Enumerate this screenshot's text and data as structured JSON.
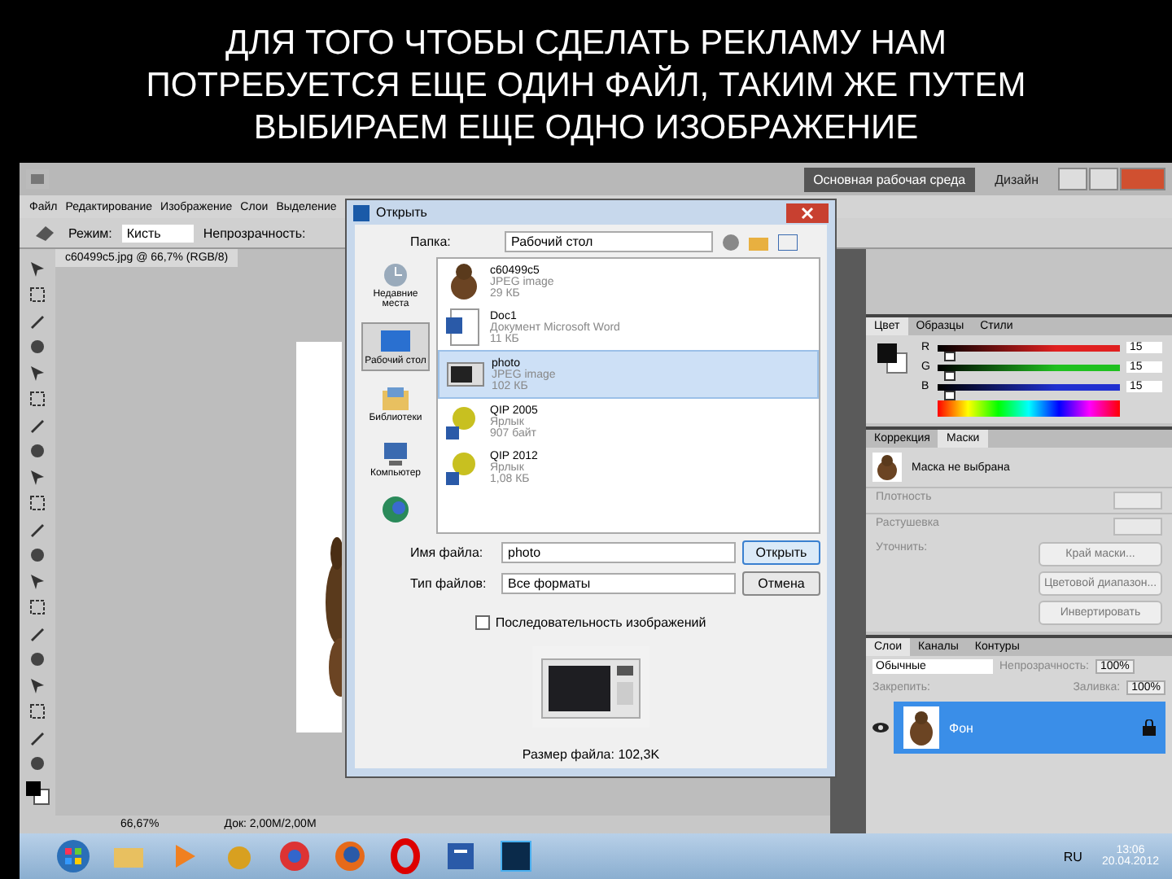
{
  "slide_title": "ДЛЯ ТОГО ЧТОБЫ СДЕЛАТЬ РЕКЛАМУ НАМ ПОТРЕБУЕТСЯ ЕЩЕ ОДИН ФАЙЛ, ТАКИМ ЖЕ ПУТЕМ ВЫБИРАЕМ ЕЩЕ ОДНО ИЗОБРАЖЕНИЕ",
  "photoshop": {
    "workspace": "Основная рабочая среда",
    "design": "Дизайн",
    "menu": [
      "Файл",
      "Редактирование",
      "Изображение",
      "Слои",
      "Выделение"
    ],
    "options": {
      "mode_label": "Режим:",
      "mode_value": "Кисть",
      "opacity_label": "Непрозрачность:"
    },
    "document_tab": "c60499c5.jpg @ 66,7% (RGB/8)",
    "color_panel": {
      "tabs": [
        {
          "label": "Цвет",
          "selected": true
        },
        {
          "label": "Образцы",
          "selected": false
        },
        {
          "label": "Стили",
          "selected": false
        }
      ],
      "channels": [
        {
          "name": "R",
          "value": "15",
          "level": 0.06,
          "color": "#e02020"
        },
        {
          "name": "G",
          "value": "15",
          "level": 0.06,
          "color": "#20c020"
        },
        {
          "name": "B",
          "value": "15",
          "level": 0.06,
          "color": "#2030d0"
        }
      ]
    },
    "masks_panel": {
      "tabs": [
        {
          "label": "Коррекция",
          "selected": false
        },
        {
          "label": "Маски",
          "selected": true
        }
      ],
      "mask_state": "Маска не выбрана",
      "rows": [
        "Плотность",
        "Растушевка"
      ],
      "section": "Уточнить:",
      "buttons": [
        "Край маски...",
        "Цветовой диапазон...",
        "Инвертировать"
      ]
    },
    "layers_panel": {
      "tabs": [
        {
          "label": "Слои",
          "selected": true
        },
        {
          "label": "Каналы",
          "selected": false
        },
        {
          "label": "Контуры",
          "selected": false
        }
      ],
      "blend_mode": "Обычные",
      "opacity_label": "Непрозрачность:",
      "opacity": "100%",
      "lock_label": "Закрепить:",
      "fill_label": "Заливка:",
      "fill": "100%",
      "layers": [
        {
          "name": "Фон",
          "selected": true,
          "visible": true
        }
      ]
    },
    "status": {
      "zoom": "66,67%",
      "doc": "Док: 2,00M/2,00M"
    }
  },
  "dialog": {
    "title": "Открыть",
    "folder_label": "Папка:",
    "folder": "Рабочий стол",
    "places": [
      {
        "label": "Недавние места",
        "selected": false,
        "kind": "recent"
      },
      {
        "label": "Рабочий стол",
        "selected": true,
        "kind": "desktop"
      },
      {
        "label": "Библиотеки",
        "selected": false,
        "kind": "libraries"
      },
      {
        "label": "Компьютер",
        "selected": false,
        "kind": "computer"
      },
      {
        "selected": false,
        "kind": "network"
      }
    ],
    "files": [
      {
        "name": "c60499c5",
        "type": "JPEG image",
        "size": "29 КБ",
        "selected": false
      },
      {
        "name": "Doc1",
        "type": "Документ Microsoft Word",
        "size": "11 КБ",
        "kind": "word",
        "selected": false
      },
      {
        "name": "photo",
        "type": "JPEG image",
        "size": "102 КБ",
        "kind": "microwave",
        "selected": true
      },
      {
        "name": "QIP 2005",
        "type": "Ярлык",
        "size": "907 байт",
        "kind": "shortcut",
        "selected": false
      },
      {
        "name": "QIP 2012",
        "type": "Ярлык",
        "size": "1,08 КБ",
        "kind": "shortcut",
        "selected": false
      }
    ],
    "filename_label": "Имя файла:",
    "filename": "photo",
    "filetype_label": "Тип файлов:",
    "filetype": "Все форматы",
    "open_button": "Открыть",
    "cancel_button": "Отмена",
    "sequence": {
      "label": "Последовательность изображений",
      "checked": false
    },
    "file_size": "Размер файла: 102,3K"
  },
  "taskbar": {
    "language": "RU",
    "time": "13:06",
    "date": "20.04.2012"
  }
}
